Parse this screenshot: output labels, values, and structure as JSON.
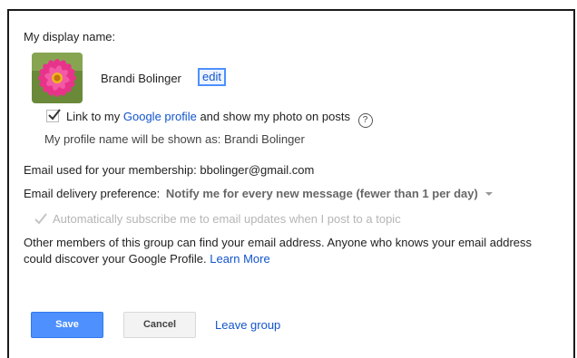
{
  "section": {
    "title": "My display name:"
  },
  "profile": {
    "display_name": "Brandi Bolinger",
    "edit_label": "edit"
  },
  "link_profile": {
    "checked": true,
    "text_before": "Link to my",
    "link_text": "Google profile",
    "text_after": "and show my photo on posts",
    "help_icon": "?"
  },
  "profile_name_note": "My profile name will be shown as: Brandi Bolinger",
  "email": {
    "label": "Email used for your membership:",
    "value": "bbolinger@gmail.com"
  },
  "delivery": {
    "label": "Email delivery preference:",
    "selected": "Notify me for every new message (fewer than 1 per day)"
  },
  "auto_subscribe": {
    "checked": true,
    "disabled": true,
    "label": "Automatically subscribe me to email updates when I post to a topic"
  },
  "info": {
    "text": "Other members of this group can find your email address. Anyone who knows your email address could discover your Google Profile.",
    "link_text": "Learn More"
  },
  "actions": {
    "save_label": "Save",
    "cancel_label": "Cancel",
    "leave_label": "Leave group"
  },
  "colors": {
    "accent": "#4d90fe",
    "link": "#1155cc",
    "disabled": "#b5b5b5"
  }
}
